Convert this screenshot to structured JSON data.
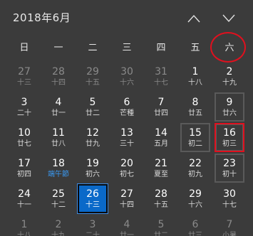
{
  "header": {
    "title": "2018年6月",
    "prev_icon": "chevron-up-icon",
    "next_icon": "chevron-down-icon"
  },
  "colors": {
    "background": "#3b3b3b",
    "today_fill": "#0a69c9",
    "annotation_red": "#e0101e",
    "festival_blue": "#3a98f0"
  },
  "weekdays": [
    "日",
    "一",
    "二",
    "三",
    "四",
    "五",
    "六"
  ],
  "days": [
    {
      "n": "27",
      "l": "十三",
      "dim": true
    },
    {
      "n": "28",
      "l": "十四",
      "dim": true
    },
    {
      "n": "29",
      "l": "十五",
      "dim": true
    },
    {
      "n": "30",
      "l": "十六",
      "dim": true
    },
    {
      "n": "31",
      "l": "十七",
      "dim": true
    },
    {
      "n": "1",
      "l": "十八"
    },
    {
      "n": "2",
      "l": "十九"
    },
    {
      "n": "3",
      "l": "二十"
    },
    {
      "n": "4",
      "l": "廿一"
    },
    {
      "n": "5",
      "l": "廿二"
    },
    {
      "n": "6",
      "l": "芒種"
    },
    {
      "n": "7",
      "l": "廿四"
    },
    {
      "n": "8",
      "l": "廿五"
    },
    {
      "n": "9",
      "l": "廿六",
      "boxed": true
    },
    {
      "n": "10",
      "l": "廿七"
    },
    {
      "n": "11",
      "l": "廿八"
    },
    {
      "n": "12",
      "l": "廿九"
    },
    {
      "n": "13",
      "l": "三十"
    },
    {
      "n": "14",
      "l": "五月"
    },
    {
      "n": "15",
      "l": "初二",
      "boxed": true
    },
    {
      "n": "16",
      "l": "初三",
      "redbox": true
    },
    {
      "n": "17",
      "l": "初四"
    },
    {
      "n": "18",
      "l": "端午節",
      "festival": true
    },
    {
      "n": "19",
      "l": "初六"
    },
    {
      "n": "20",
      "l": "初七"
    },
    {
      "n": "21",
      "l": "夏至"
    },
    {
      "n": "22",
      "l": "初九"
    },
    {
      "n": "23",
      "l": "初十",
      "boxed": true
    },
    {
      "n": "24",
      "l": "十一"
    },
    {
      "n": "25",
      "l": "十二"
    },
    {
      "n": "26",
      "l": "十三",
      "today": true
    },
    {
      "n": "27",
      "l": "十四"
    },
    {
      "n": "28",
      "l": "十五"
    },
    {
      "n": "29",
      "l": "十六"
    },
    {
      "n": "30",
      "l": "十七"
    },
    {
      "n": "1",
      "l": "十八",
      "dim": true
    },
    {
      "n": "2",
      "l": "十九",
      "dim": true
    },
    {
      "n": "3",
      "l": "二十",
      "dim": true
    },
    {
      "n": "4",
      "l": "廿一",
      "dim": true
    },
    {
      "n": "5",
      "l": "廿二",
      "dim": true
    },
    {
      "n": "6",
      "l": "廿三",
      "dim": true
    },
    {
      "n": "7",
      "l": "小暑",
      "dim": true
    }
  ]
}
